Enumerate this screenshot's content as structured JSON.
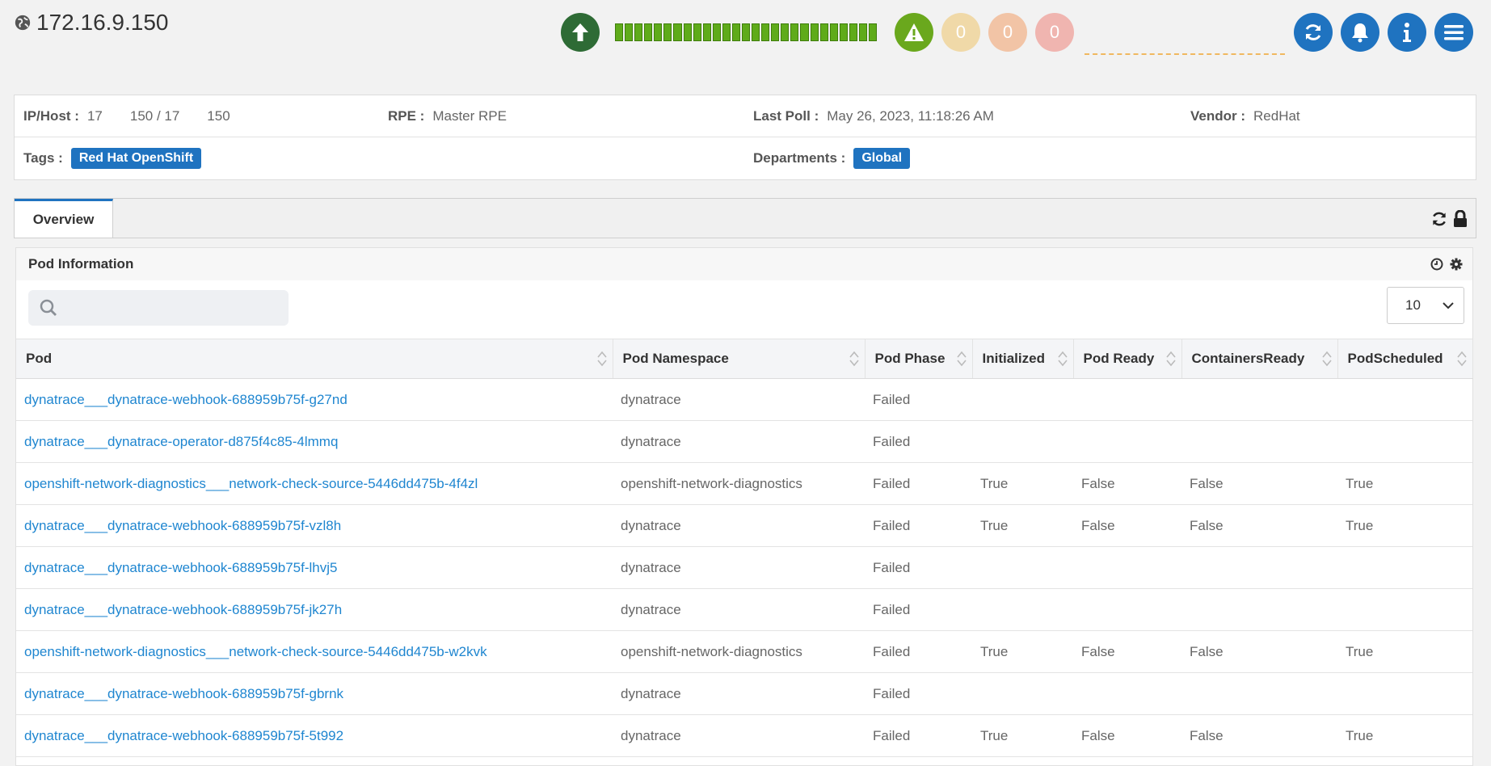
{
  "header": {
    "title": "172.16.9.150",
    "globe_icon": "globe-icon",
    "status_icon": "arrow-up-icon",
    "status_color": "#2e6b35",
    "availability_segments": 27,
    "availability_color": "#5fab1a",
    "alarm_icon": "warning-icon",
    "alarm_counts": [
      "0",
      "0",
      "0"
    ],
    "buttons": [
      "refresh-icon",
      "bell-icon",
      "info-icon",
      "menu-icon"
    ],
    "accent": "#1f73c0"
  },
  "info": {
    "ip_label": "IP/Host :",
    "ip_value": "17    150 / 17    150",
    "rpe_label": "RPE :",
    "rpe_value": "Master RPE",
    "lastpoll_label": "Last Poll :",
    "lastpoll_value": "May 26, 2023, 11:18:26 AM",
    "vendor_label": "Vendor :",
    "vendor_value": "RedHat",
    "tags_label": "Tags :",
    "tag": "Red Hat OpenShift",
    "departments_label": "Departments :",
    "department": "Global"
  },
  "tabs": [
    {
      "label": "Overview",
      "active": true
    }
  ],
  "panel": {
    "title": "Pod Information",
    "search_placeholder": "",
    "page_size": "10"
  },
  "table": {
    "columns": [
      "Pod",
      "Pod Namespace",
      "Pod Phase",
      "Initialized",
      "Pod Ready",
      "ContainersReady",
      "PodScheduled"
    ],
    "rows": [
      [
        "dynatrace___dynatrace-webhook-688959b75f-g27nd",
        "dynatrace",
        "Failed",
        "",
        "",
        "",
        ""
      ],
      [
        "dynatrace___dynatrace-operator-d875f4c85-4lmmq",
        "dynatrace",
        "Failed",
        "",
        "",
        "",
        ""
      ],
      [
        "openshift-network-diagnostics___network-check-source-5446dd475b-4f4zl",
        "openshift-network-diagnostics",
        "Failed",
        "True",
        "False",
        "False",
        "True"
      ],
      [
        "dynatrace___dynatrace-webhook-688959b75f-vzl8h",
        "dynatrace",
        "Failed",
        "True",
        "False",
        "False",
        "True"
      ],
      [
        "dynatrace___dynatrace-webhook-688959b75f-lhvj5",
        "dynatrace",
        "Failed",
        "",
        "",
        "",
        ""
      ],
      [
        "dynatrace___dynatrace-webhook-688959b75f-jk27h",
        "dynatrace",
        "Failed",
        "",
        "",
        "",
        ""
      ],
      [
        "openshift-network-diagnostics___network-check-source-5446dd475b-w2kvk",
        "openshift-network-diagnostics",
        "Failed",
        "True",
        "False",
        "False",
        "True"
      ],
      [
        "dynatrace___dynatrace-webhook-688959b75f-gbrnk",
        "dynatrace",
        "Failed",
        "",
        "",
        "",
        ""
      ],
      [
        "dynatrace___dynatrace-webhook-688959b75f-5t992",
        "dynatrace",
        "Failed",
        "True",
        "False",
        "False",
        "True"
      ]
    ]
  }
}
